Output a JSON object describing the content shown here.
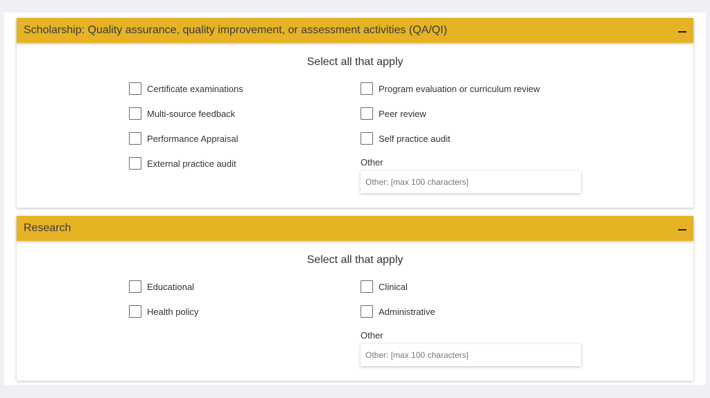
{
  "qa_section": {
    "title": "Scholarship: Quality assurance, quality improvement, or assessment activities (QA/QI)",
    "collapse_icon": "minus-icon",
    "select_title": "Select all that apply",
    "options_left": [
      "Certificate examinations",
      "Multi-source feedback",
      "Performance Appraisal",
      "External practice audit"
    ],
    "options_right": [
      "Program evaluation or curriculum review",
      "Peer review",
      "Self practice audit"
    ],
    "other_label": "Other",
    "other_placeholder": "Other: [max 100 characters]",
    "other_value": ""
  },
  "research_section": {
    "title": "Research",
    "collapse_icon": "minus-icon",
    "select_title": "Select all that apply",
    "options_left": [
      "Educational",
      "Health policy"
    ],
    "options_right": [
      "Clinical",
      "Administrative"
    ],
    "other_label": "Other",
    "other_placeholder": "Other: [max 100 characters]",
    "other_value": ""
  },
  "colors": {
    "header_bg": "#e6b325",
    "page_bg": "#eef0f3"
  }
}
